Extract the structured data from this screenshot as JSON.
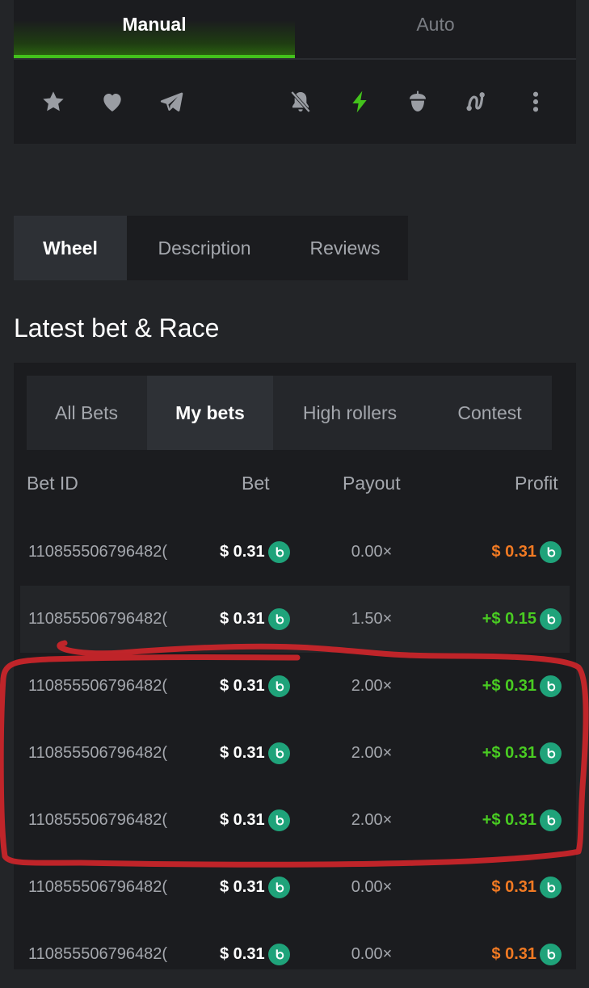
{
  "mode_tabs": {
    "manual": "Manual",
    "auto": "Auto"
  },
  "toolbar_icons": [
    "star-icon",
    "heart-icon",
    "telegram-icon",
    "sound-off-icon",
    "lightning-icon",
    "acorn-icon",
    "path-icon",
    "more-vertical-icon"
  ],
  "game_tabs": [
    "Wheel",
    "Description",
    "Reviews"
  ],
  "section_title": "Latest bet & Race",
  "bet_tabs": [
    "All Bets",
    "My bets",
    "High rollers",
    "Contest"
  ],
  "columns": {
    "bet_id": "Bet ID",
    "bet": "Bet",
    "payout": "Payout",
    "profit": "Profit"
  },
  "rows": [
    {
      "bet_id": "110855506796482(",
      "bet": "$ 0.31",
      "payout": "0.00×",
      "profit": "$ 0.31",
      "profit_type": "loss"
    },
    {
      "bet_id": "110855506796482(",
      "bet": "$ 0.31",
      "payout": "1.50×",
      "profit": "+$ 0.15",
      "profit_type": "win"
    },
    {
      "bet_id": "110855506796482(",
      "bet": "$ 0.31",
      "payout": "2.00×",
      "profit": "+$ 0.31",
      "profit_type": "win"
    },
    {
      "bet_id": "110855506796482(",
      "bet": "$ 0.31",
      "payout": "2.00×",
      "profit": "+$ 0.31",
      "profit_type": "win"
    },
    {
      "bet_id": "110855506796482(",
      "bet": "$ 0.31",
      "payout": "2.00×",
      "profit": "+$ 0.31",
      "profit_type": "win"
    },
    {
      "bet_id": "110855506796482(",
      "bet": "$ 0.31",
      "payout": "0.00×",
      "profit": "$ 0.31",
      "profit_type": "loss"
    },
    {
      "bet_id": "110855506796482(",
      "bet": "$ 0.31",
      "payout": "0.00×",
      "profit": "$ 0.31",
      "profit_type": "loss"
    }
  ],
  "colors": {
    "accent": "#43c21c",
    "win": "#49cc22",
    "loss": "#f17a23",
    "coin": "#1fa37a",
    "annotation": "#d2262a"
  }
}
